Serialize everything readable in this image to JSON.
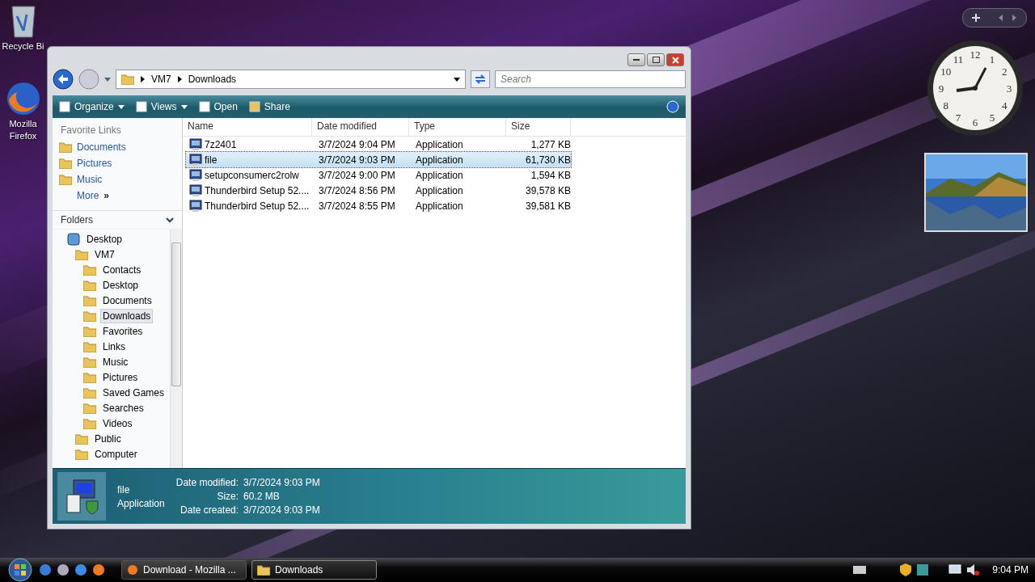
{
  "desktop_icons": [
    {
      "label": "Recycle Bi",
      "kind": "bin"
    },
    {
      "label": "Mozilla Firefox",
      "kind": "browser"
    }
  ],
  "window": {
    "address": [
      "VM7",
      "Downloads"
    ],
    "search": {
      "placeholder": "Search"
    },
    "toolbar": [
      {
        "label": "Organize",
        "has_menu": true
      },
      {
        "label": "Views",
        "has_menu": true
      },
      {
        "label": "Open",
        "has_menu": false
      },
      {
        "label": "Share",
        "has_menu": false
      }
    ],
    "favorite_links": {
      "title": "Favorite Links",
      "items": [
        "Documents",
        "Pictures",
        "Music"
      ],
      "more": "More",
      "more_glyph": "»"
    },
    "folders": {
      "title": "Folders",
      "tree": [
        {
          "label": "Desktop",
          "selected": false,
          "children": [
            {
              "label": "VM7",
              "selected": false,
              "children": [
                {
                  "label": "Contacts",
                  "selected": false
                },
                {
                  "label": "Desktop",
                  "selected": false
                },
                {
                  "label": "Documents",
                  "selected": false
                },
                {
                  "label": "Downloads",
                  "selected": true
                },
                {
                  "label": "Favorites",
                  "selected": false
                },
                {
                  "label": "Links",
                  "selected": false
                },
                {
                  "label": "Music",
                  "selected": false
                },
                {
                  "label": "Pictures",
                  "selected": false
                },
                {
                  "label": "Saved Games",
                  "selected": false
                },
                {
                  "label": "Searches",
                  "selected": false
                },
                {
                  "label": "Videos",
                  "selected": false
                }
              ]
            },
            {
              "label": "Public",
              "selected": false
            },
            {
              "label": "Computer",
              "selected": false
            }
          ]
        }
      ]
    },
    "table": {
      "columns": [
        "Name",
        "Date modified",
        "Type",
        "Size"
      ],
      "rows": [
        {
          "name": "7z2401",
          "date": "3/7/2024 9:04 PM",
          "type": "Application",
          "size": "1,277 KB",
          "selected": false
        },
        {
          "name": "file",
          "date": "3/7/2024 9:03 PM",
          "type": "Application",
          "size": "61,730 KB",
          "selected": true
        },
        {
          "name": "setupconsumerc2rolw",
          "date": "3/7/2024 9:00 PM",
          "type": "Application",
          "size": "1,594 KB",
          "selected": false
        },
        {
          "name": "Thunderbird Setup 52....",
          "date": "3/7/2024 8:56 PM",
          "type": "Application",
          "size": "39,578 KB",
          "selected": false
        },
        {
          "name": "Thunderbird Setup 52....",
          "date": "3/7/2024 8:55 PM",
          "type": "Application",
          "size": "39,581 KB",
          "selected": false
        }
      ]
    },
    "details": {
      "name": "file",
      "type": "Application",
      "properties": [
        {
          "label": "Date modified:",
          "value": "3/7/2024 9:03 PM"
        },
        {
          "label": "Size:",
          "value": "60.2 MB"
        },
        {
          "label": "Date created:",
          "value": "3/7/2024 9:03 PM"
        }
      ]
    }
  },
  "clock": {
    "numerals": [
      "12",
      "1",
      "2",
      "3",
      "4",
      "5",
      "6",
      "7",
      "8",
      "9",
      "10",
      "11"
    ]
  },
  "taskbar": {
    "tasks": [
      {
        "label": "Download - Mozilla ...",
        "selected": false
      },
      {
        "label": "Downloads",
        "selected": true
      }
    ],
    "time": "9:04 PM"
  }
}
